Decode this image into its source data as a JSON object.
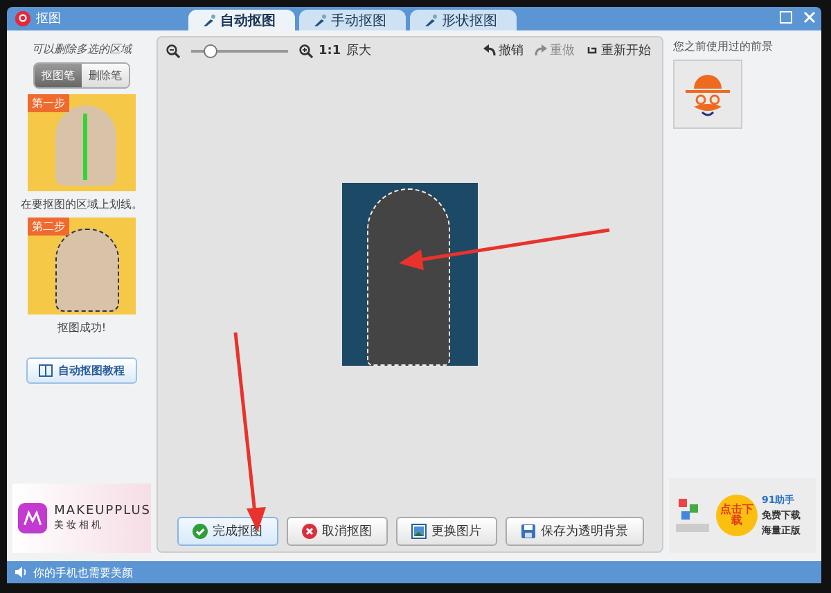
{
  "window": {
    "title": "抠图"
  },
  "tabs": [
    {
      "label": "自动抠图",
      "selected": true
    },
    {
      "label": "手动抠图",
      "selected": false
    },
    {
      "label": "形状抠图",
      "selected": false
    }
  ],
  "left_panel": {
    "hint": "可以删除多选的区域",
    "modes": [
      {
        "label": "抠图笔",
        "selected": true
      },
      {
        "label": "删除笔",
        "selected": false
      }
    ],
    "steps": [
      {
        "badge": "第一步",
        "caption": "在要抠图的区域上划线。",
        "kind": "stroke"
      },
      {
        "badge": "第二步",
        "caption": "抠图成功!",
        "kind": "outline"
      }
    ],
    "tutorial_button": "自动抠图教程",
    "ad": {
      "brand": "MAKEUPPLUS",
      "subtitle": "美妆相机"
    }
  },
  "toolbar": {
    "zoom": {
      "level": 0.2
    },
    "ratio": "1:1",
    "original_size": "原大",
    "undo": {
      "label": "撤销",
      "disabled": false
    },
    "redo": {
      "label": "重做",
      "disabled": true
    },
    "restart": "重新开始"
  },
  "actions": [
    {
      "label": "完成抠图",
      "kind": "done",
      "selected": true
    },
    {
      "label": "取消抠图",
      "kind": "cancel",
      "selected": false
    },
    {
      "label": "更换图片",
      "kind": "image",
      "selected": false
    },
    {
      "label": "保存为透明背景",
      "kind": "save",
      "selected": false
    }
  ],
  "right_panel": {
    "title": "您之前使用过的前景",
    "ad": {
      "button": "点击下载",
      "brand": "91助手",
      "line_1": "免费下载",
      "line_2": "海量正版"
    }
  },
  "status_bar": "你的手机也需要美颜"
}
